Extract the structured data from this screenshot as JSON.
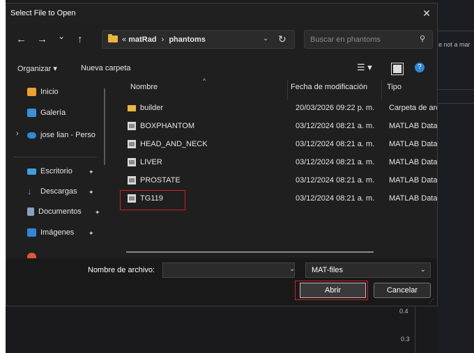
{
  "background_app": {
    "clipped_text": "e not a mar",
    "axis_ticks": [
      "0.4",
      "0.3"
    ]
  },
  "dialog": {
    "title": "Select File to Open",
    "close_glyph": "✕",
    "nav": {
      "back": "←",
      "forward": "→",
      "recent": "⌄",
      "up": "↑"
    },
    "address": {
      "prefix": "«",
      "crumbs": [
        "matRad",
        "phantoms"
      ],
      "separator": "›"
    },
    "search": {
      "placeholder": "Buscar en phantoms"
    },
    "toolbar": {
      "organize": "Organizar ▾",
      "new_folder": "Nueva carpeta"
    },
    "sidebar": {
      "items": [
        {
          "label": "Inicio",
          "color": "#f0a030"
        },
        {
          "label": "Galería",
          "color": "#3c8fd9"
        },
        {
          "label": "jose lian - Perso",
          "color": "#2d8ad8"
        },
        {
          "label": "Escritorio",
          "color": "#3aa0e0"
        },
        {
          "label": "Descargas",
          "color": "#3aa0e0"
        },
        {
          "label": "Documentos",
          "color": "#8aa0c0"
        },
        {
          "label": "Imágenes",
          "color": "#2f86d6"
        }
      ]
    },
    "columns": {
      "name": "Nombre",
      "modified": "Fecha de modificación",
      "type": "Tipo"
    },
    "files": [
      {
        "name": "builder",
        "icon": "folder",
        "modified": "20/03/2026 09:22 p. m.",
        "type": "Carpeta de archi"
      },
      {
        "name": "BOXPHANTOM",
        "icon": "file",
        "modified": "03/12/2024 08:21 a. m.",
        "type": "MATLAB Data"
      },
      {
        "name": "HEAD_AND_NECK",
        "icon": "file",
        "modified": "03/12/2024 08:21 a. m.",
        "type": "MATLAB Data"
      },
      {
        "name": "LIVER",
        "icon": "file",
        "modified": "03/12/2024 08:21 a. m.",
        "type": "MATLAB Data"
      },
      {
        "name": "PROSTATE",
        "icon": "file",
        "modified": "03/12/2024 08:21 a. m.",
        "type": "MATLAB Data"
      },
      {
        "name": "TG119",
        "icon": "file",
        "modified": "03/12/2024 08:21 a. m.",
        "type": "MATLAB Data"
      }
    ],
    "footer": {
      "filename_label": "Nombre de archivo:",
      "filename_value": "",
      "filter_value": "MAT-files",
      "open_label": "Abrir",
      "cancel_label": "Cancelar"
    }
  }
}
